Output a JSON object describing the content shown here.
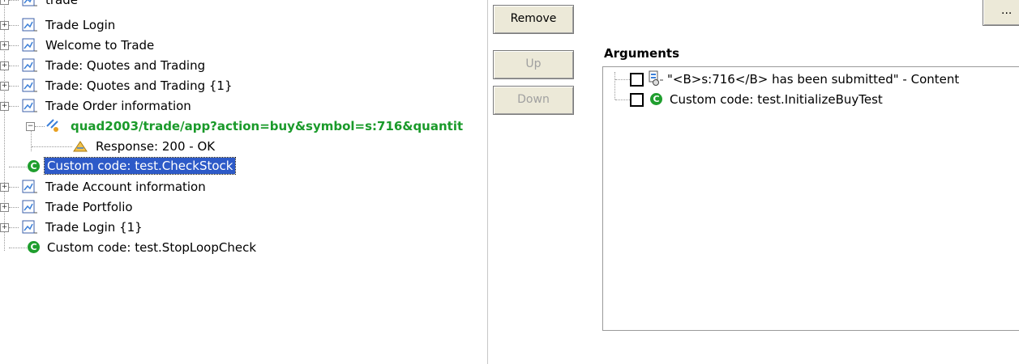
{
  "tree": {
    "items": [
      {
        "label": "trade"
      },
      {
        "label": "Trade Login"
      },
      {
        "label": "Welcome to Trade"
      },
      {
        "label": "Trade: Quotes and Trading"
      },
      {
        "label": "Trade: Quotes and Trading {1}"
      },
      {
        "label": "Trade Order information"
      },
      {
        "label": "quad2003/trade/app?action=buy&symbol=s:716&quantit"
      },
      {
        "label": "Response: 200 - OK"
      },
      {
        "label": "Custom code: test.CheckStock"
      },
      {
        "label": "Trade Account information"
      },
      {
        "label": "Trade Portfolio"
      },
      {
        "label": "Trade Login {1}"
      },
      {
        "label": "Custom code: test.StopLoopCheck"
      }
    ]
  },
  "buttons": {
    "remove": "Remove",
    "up": "Up",
    "down": "Down",
    "corner": "..."
  },
  "arguments": {
    "title": "Arguments",
    "items": [
      {
        "label": "\"<B>s:716</B> has been submitted\" - Content"
      },
      {
        "label": "Custom code: test.InitializeBuyTest"
      }
    ]
  },
  "colors": {
    "selection": "#2d5ac8",
    "http_link": "#1a9a2a",
    "custom_code_icon": "#1f9e2e",
    "button_face": "#ece9d8"
  }
}
